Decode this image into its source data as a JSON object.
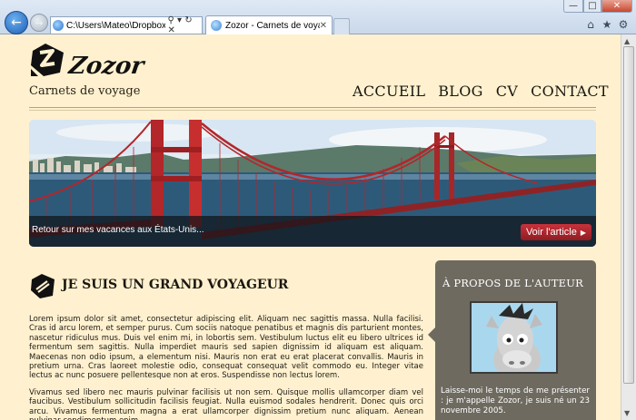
{
  "browser": {
    "address_url": "C:\\Users\\Mateo\\Dropbox\\D",
    "tab_title": "Zozor - Carnets de voyage",
    "tab_close": "✕",
    "address_tools": "⚲ ▾ ↻ ✕",
    "back_glyph": "←",
    "forward_glyph": "→",
    "icons": [
      "back-arrow-icon",
      "forward-arrow-icon",
      "ie-page-icon",
      "search-icon",
      "refresh-icon",
      "stop-icon",
      "home-icon",
      "star-icon",
      "gear-icon"
    ],
    "window_controls": {
      "minimize": "—",
      "maximize": "□",
      "close": "✕"
    },
    "toolbar": {
      "home": "⌂",
      "favorites": "★",
      "tools": "⚙"
    }
  },
  "site": {
    "logo_text": "Zozor",
    "tagline": "Carnets de voyage",
    "menu": [
      "ACCUEIL",
      "BLOG",
      "CV",
      "CONTACT"
    ]
  },
  "banner": {
    "caption": "Retour sur mes vacances aux États-Unis...",
    "button_label": "Voir l'article",
    "button_caret": "▶",
    "accent_color": "#b2272e"
  },
  "article": {
    "title": "JE SUIS UN GRAND VOYAGEUR",
    "paragraphs": [
      "Lorem ipsum dolor sit amet, consectetur adipiscing elit. Aliquam nec sagittis massa. Nulla facilisi. Cras id arcu lorem, et semper purus. Cum sociis natoque penatibus et magnis dis parturient montes, nascetur ridiculus mus. Duis vel enim mi, in lobortis sem. Vestibulum luctus elit eu libero ultrices id fermentum sem sagittis. Nulla imperdiet mauris sed sapien dignissim id aliquam est aliquam. Maecenas non odio ipsum, a elementum nisi. Mauris non erat eu erat placerat convallis. Mauris in pretium urna. Cras laoreet molestie odio, consequat consequat velit commodo eu. Integer vitae lectus ac nunc posuere pellentesque non at eros. Suspendisse non lectus lorem.",
      "Vivamus sed libero nec mauris pulvinar facilisis ut non sem. Quisque mollis ullamcorper diam vel faucibus. Vestibulum sollicitudin facilisis feugiat. Nulla euismod sodales hendrerit. Donec quis orci arcu. Vivamus fermentum magna a erat ullamcorper dignissim pretium nunc aliquam. Aenean pulvinar condimentum enim"
    ]
  },
  "aside": {
    "title": "À PROPOS DE L'AUTEUR",
    "text": "Laisse-moi le temps de me présenter : je m'appelle Zozor, je suis né un 23 novembre 2005."
  },
  "colors": {
    "page_background": "#fff1cf",
    "aside_background": "#6e6a60",
    "text": "#1d1a14"
  }
}
